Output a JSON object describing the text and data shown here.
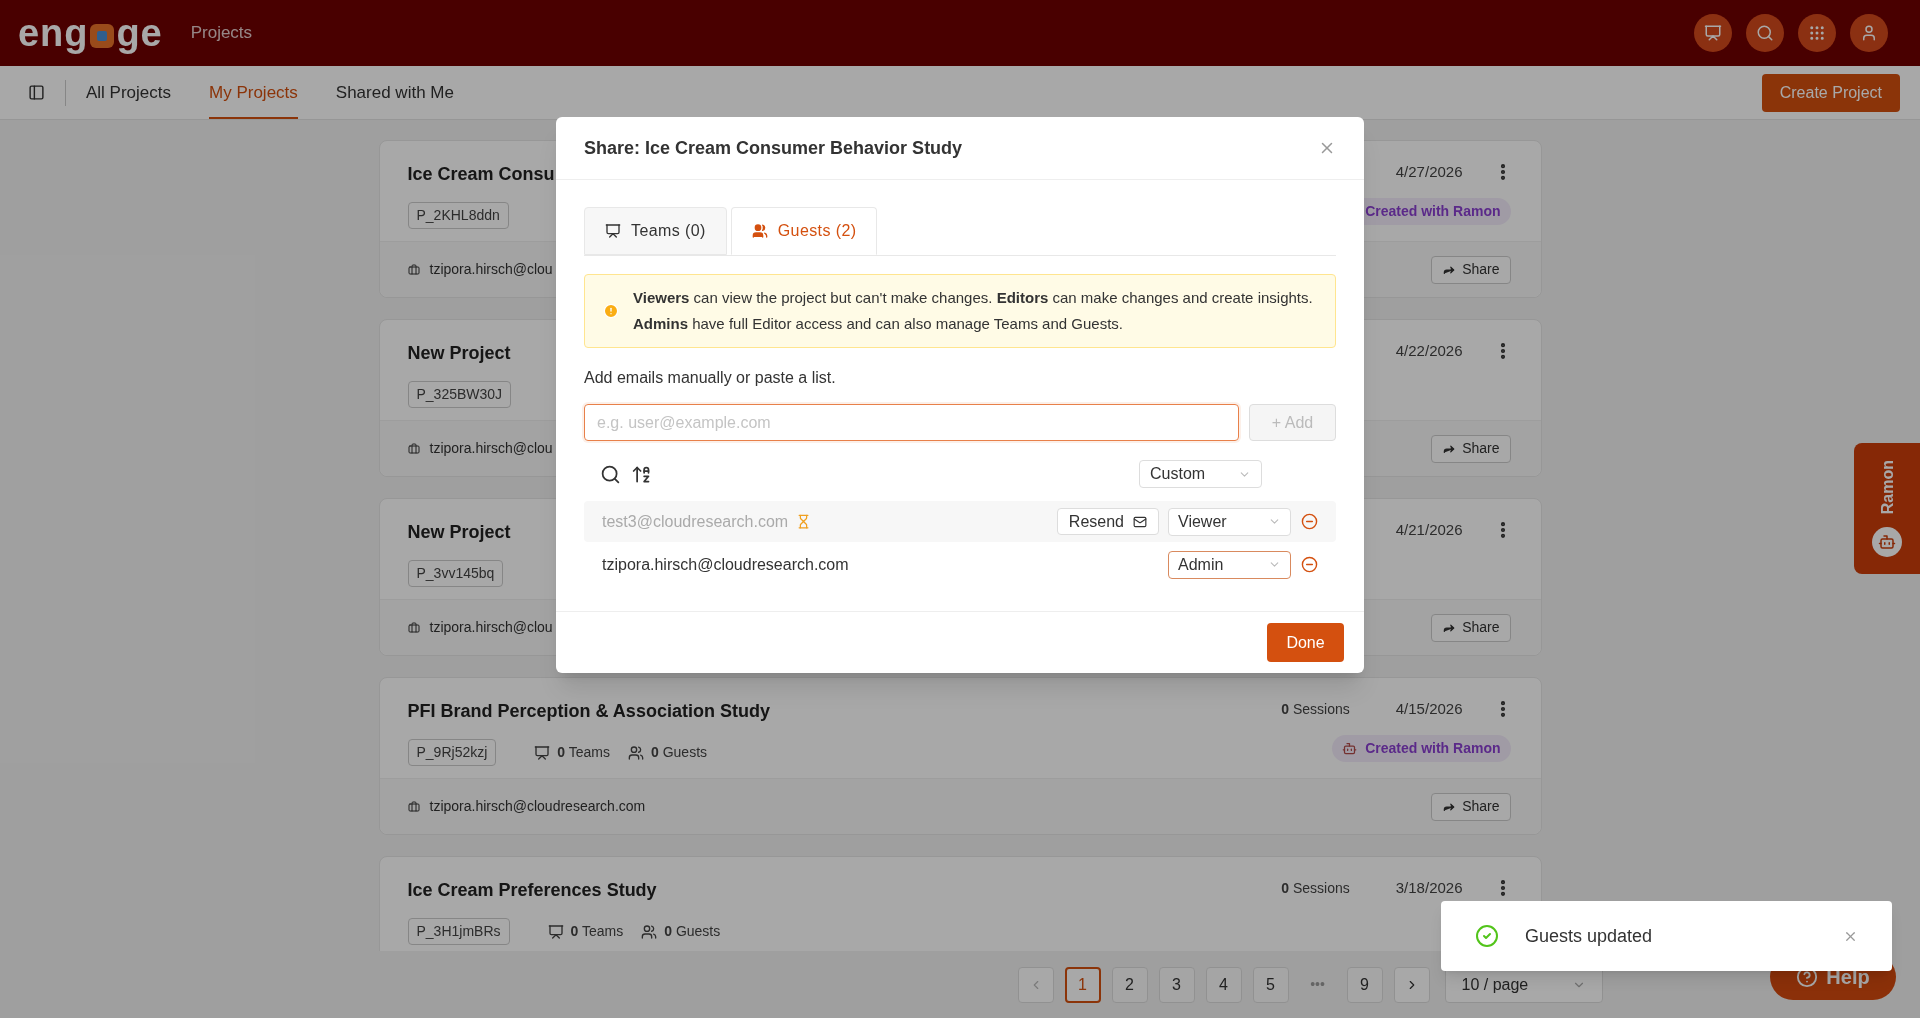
{
  "header": {
    "logo": {
      "before": "eng",
      "after": "ge"
    },
    "section": "Projects"
  },
  "nav": {
    "tabs": [
      {
        "label": "All Projects",
        "selected": false
      },
      {
        "label": "My Projects",
        "selected": true
      },
      {
        "label": "Shared with Me",
        "selected": false
      }
    ],
    "create_button": "Create Project"
  },
  "projects": [
    {
      "title": "Ice Cream Consu",
      "id": "P_2KHL8ddn",
      "date": "4/27/2026",
      "ramon_badge": "Created with Ramon",
      "email": "tzipora.hirsch@clou",
      "share": "Share"
    },
    {
      "title": "New Project",
      "id": "P_325BW30J",
      "date": "4/22/2026",
      "email": "tzipora.hirsch@clou",
      "share": "Share"
    },
    {
      "title": "New Project",
      "id": "P_3vv145bq",
      "date": "4/21/2026",
      "email": "tzipora.hirsch@clou",
      "share": "Share"
    },
    {
      "title": "PFI Brand Perception & Association Study",
      "id": "P_9Rj52kzj",
      "teams": "**0** Teams",
      "guests": "**0** Guests",
      "sessions": "**0** Sessions",
      "date": "4/15/2026",
      "ramon_badge": "Created with Ramon",
      "badge_icon": true,
      "email": "tzipora.hirsch@cloudresearch.com",
      "share": "Share"
    },
    {
      "title": "Ice Cream Preferences Study",
      "id": "P_3H1jmBRs",
      "teams": "**0** Teams",
      "guests": "**0** Guests",
      "sessions": "**0** Sessions",
      "date": "3/18/2026"
    }
  ],
  "pagination": {
    "pages": [
      {
        "label": "1",
        "selected": true
      },
      {
        "label": "2",
        "selected": false
      },
      {
        "label": "3",
        "selected": false
      },
      {
        "label": "4",
        "selected": false
      },
      {
        "label": "5",
        "selected": false
      },
      {
        "label": "•••",
        "kind": "ellipsis"
      },
      {
        "label": "9",
        "selected": false
      }
    ],
    "page_size": "10 / page"
  },
  "ramon_tab": {
    "label": "Ramon"
  },
  "help_button": {
    "label": "Help"
  },
  "modal": {
    "title": "Share: Ice Cream Consumer Behavior Study",
    "tabs": [
      {
        "label": "Teams (0)",
        "kind": "teams",
        "selected": false
      },
      {
        "label": "Guests (2)",
        "kind": "guests",
        "selected": true
      }
    ],
    "notice": "**Viewers** can view the project but can't make changes. **Editors** can make changes and create insights. **Admins** have full Editor access and can also manage Teams and Guests.",
    "add_label": "Add emails manually or paste a list.",
    "email_field": {
      "placeholder": "e.g. user@example.com",
      "focused": true
    },
    "add_button": {
      "label": "+ Add",
      "disabled": true
    },
    "bulk_role": "Custom",
    "guests": [
      {
        "email": "test3@cloudresearch.com",
        "pending": true,
        "resend": "Resend",
        "role": "Viewer",
        "focused": false
      },
      {
        "email": "tzipora.hirsch@cloudresearch.com",
        "pending": false,
        "role": "Admin",
        "focused": true
      }
    ],
    "done_button": "Done"
  },
  "toast": {
    "message": "Guests updated"
  }
}
